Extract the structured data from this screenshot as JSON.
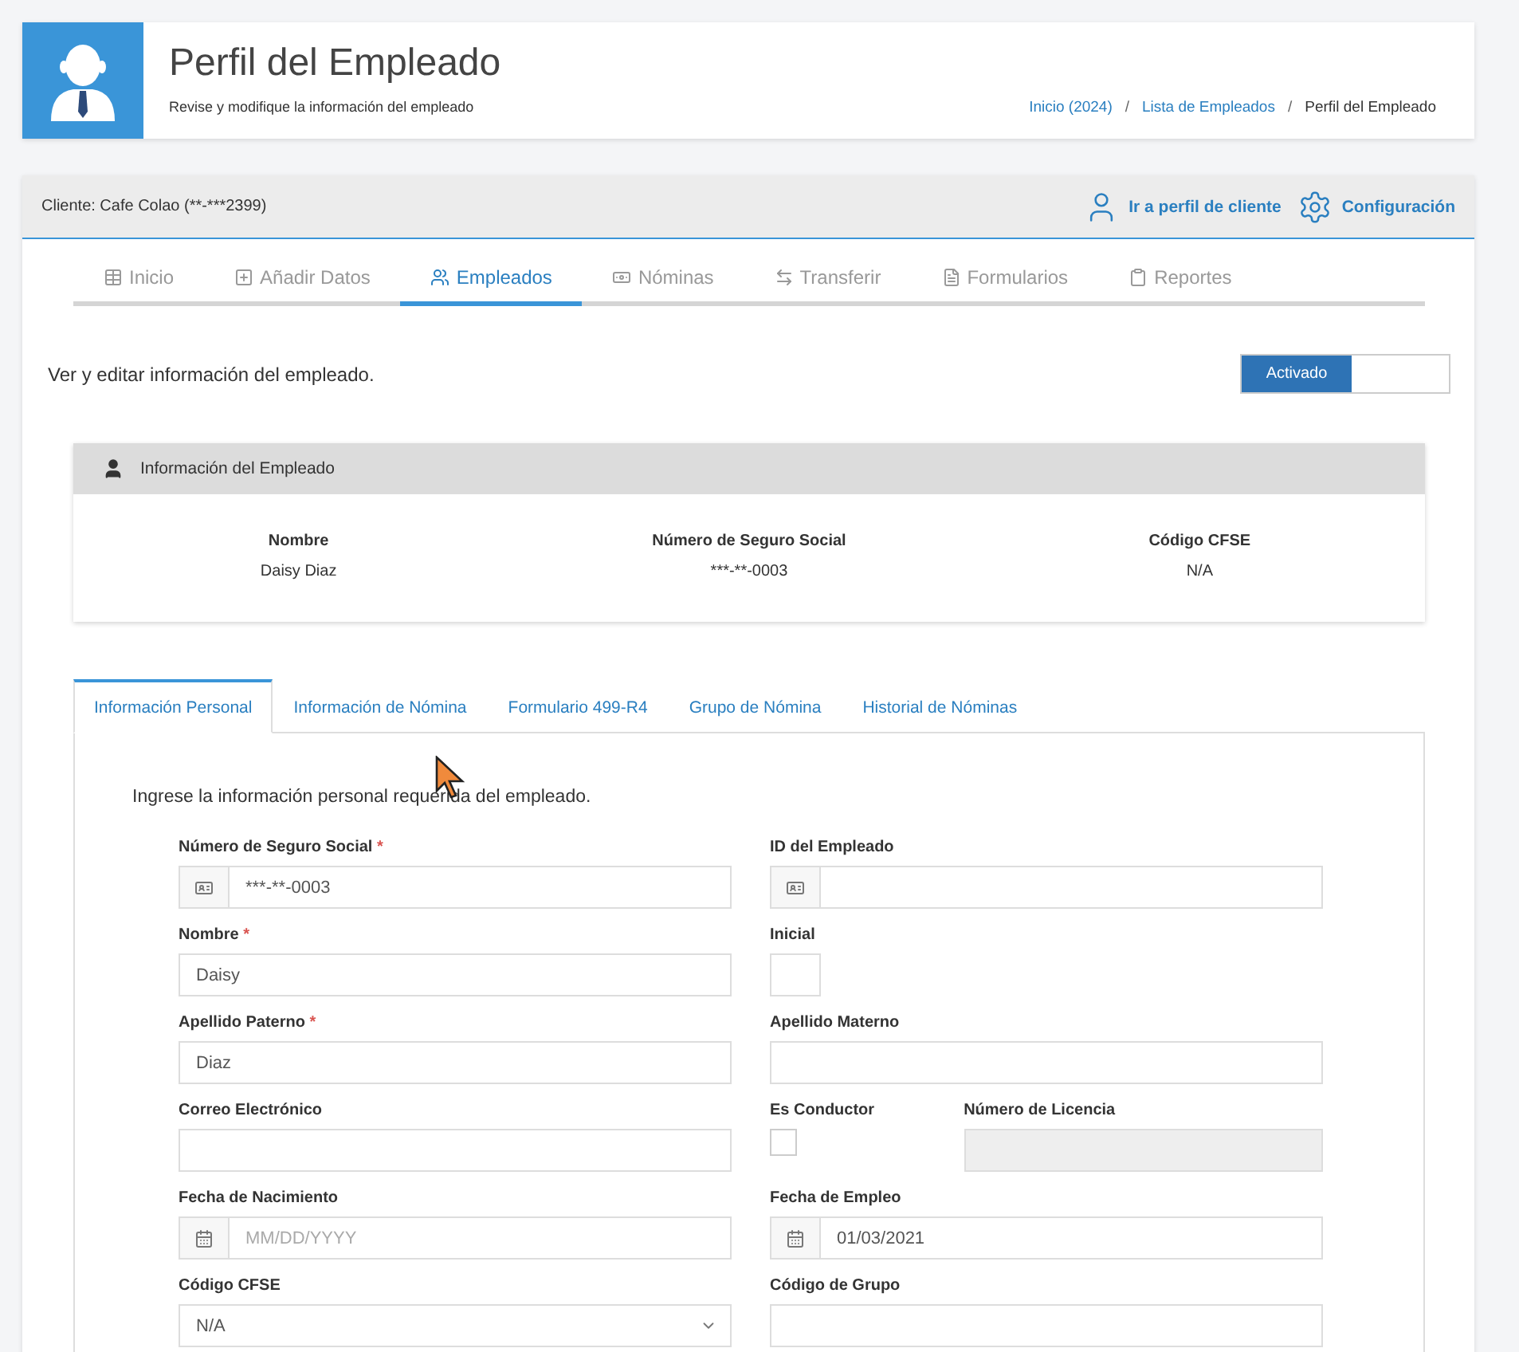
{
  "header": {
    "title": "Perfil del Empleado",
    "subtitle": "Revise y modifique la información del empleado",
    "breadcrumb_separator": "/",
    "breadcrumb": [
      {
        "label": "Inicio (2024)",
        "link": true
      },
      {
        "label": "Lista de Empleados",
        "link": true
      },
      {
        "label": "Perfil del Empleado",
        "link": false
      }
    ]
  },
  "client_bar": {
    "client": "Cliente: Cafe Colao (**-***2399)",
    "actions": [
      "Ir a perfil de cliente",
      "Configuración"
    ]
  },
  "nav_tabs": [
    {
      "label": "Inicio",
      "selected": false
    },
    {
      "label": "Añadir Datos",
      "selected": false
    },
    {
      "label": "Empleados",
      "selected": true
    },
    {
      "label": "Nóminas",
      "selected": false
    },
    {
      "label": "Transferir",
      "selected": false
    },
    {
      "label": "Formularios",
      "selected": false
    },
    {
      "label": "Reportes",
      "selected": false
    }
  ],
  "intro": "Ver y editar información del empleado.",
  "status_toggle": {
    "label": "Activado",
    "on": true
  },
  "employee_card": {
    "title": "Información del Empleado",
    "columns": [
      {
        "label": "Nombre",
        "value": "Daisy Diaz"
      },
      {
        "label": "Número de Seguro Social",
        "value": "***-**-0003"
      },
      {
        "label": "Código CFSE",
        "value": "N/A"
      }
    ]
  },
  "sub_tabs": [
    {
      "label": "Información Personal",
      "selected": true
    },
    {
      "label": "Información de Nómina",
      "selected": false
    },
    {
      "label": "Formulario 499-R4",
      "selected": false
    },
    {
      "label": "Grupo de Nómina",
      "selected": false
    },
    {
      "label": "Historial de Nóminas",
      "selected": false
    }
  ],
  "form": {
    "required_mark": "*",
    "intro": "Ingrese la información personal requerida del empleado.",
    "rows": [
      {
        "left": [
          {
            "label": "Número de Seguro Social",
            "required": true,
            "kind": "id",
            "value": "***-**-0003"
          }
        ],
        "right": [
          {
            "label": "ID del Empleado",
            "required": false,
            "kind": "id"
          }
        ]
      },
      {
        "left": [
          {
            "label": "Nombre",
            "required": true,
            "kind": "text",
            "value": "Daisy"
          }
        ],
        "right": [
          {
            "label": "Inicial",
            "required": false,
            "kind": "short"
          }
        ]
      },
      {
        "left": [
          {
            "label": "Apellido Paterno",
            "required": true,
            "kind": "text",
            "value": "Diaz"
          }
        ],
        "right": [
          {
            "label": "Apellido Materno",
            "required": false,
            "kind": "text"
          }
        ]
      },
      {
        "left": [
          {
            "label": "Correo Electrónico",
            "required": false,
            "kind": "text"
          }
        ],
        "right": [
          {
            "label": "Es Conductor",
            "required": false,
            "kind": "checkbox",
            "checked": false
          },
          {
            "label": "Número de Licencia",
            "required": false,
            "kind": "text",
            "disabled": true
          }
        ]
      },
      {
        "left": [
          {
            "label": "Fecha de Nacimiento",
            "required": false,
            "kind": "date",
            "placeholder": "MM/DD/YYYY"
          }
        ],
        "right": [
          {
            "label": "Fecha de Empleo",
            "required": false,
            "kind": "date",
            "value": "01/03/2021"
          }
        ]
      },
      {
        "left": [
          {
            "label": "Código CFSE",
            "required": false,
            "kind": "select",
            "value": "N/A"
          }
        ],
        "right": [
          {
            "label": "Código de Grupo",
            "required": false,
            "kind": "text"
          }
        ]
      }
    ]
  }
}
